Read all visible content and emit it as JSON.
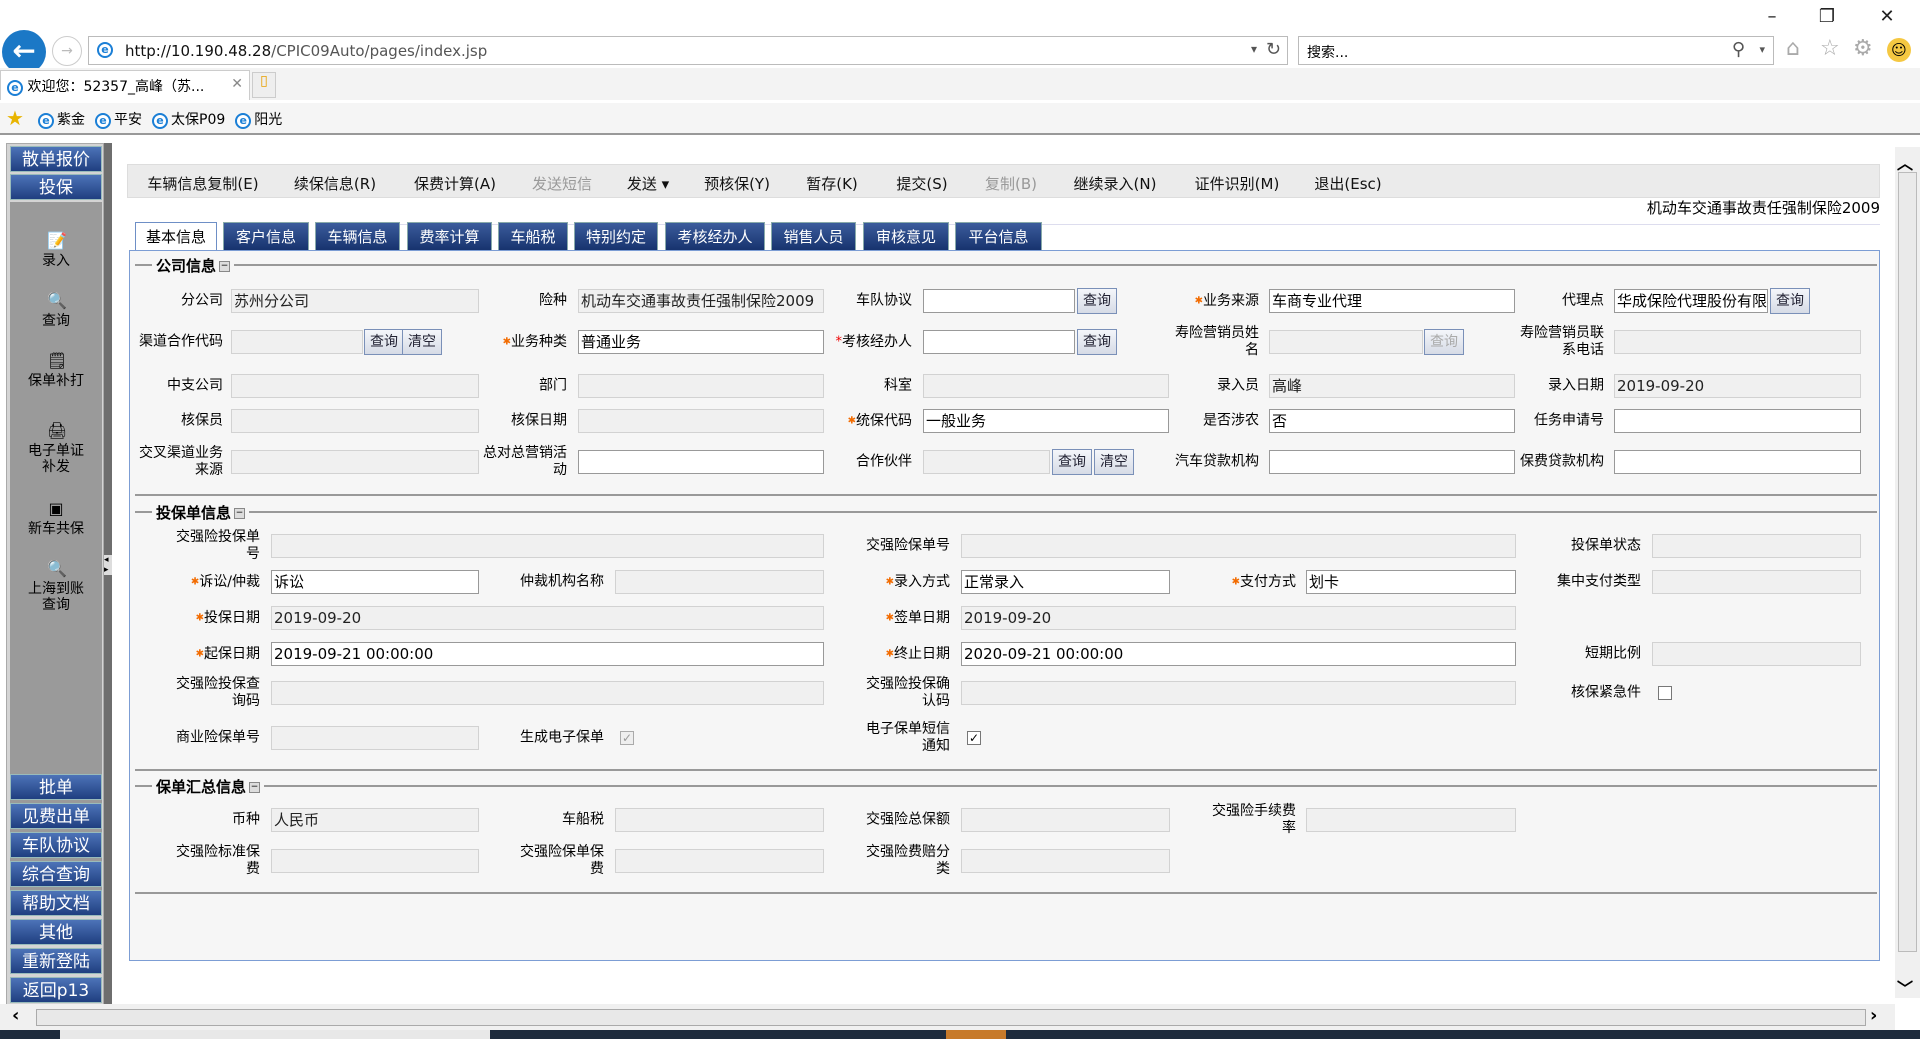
{
  "browser": {
    "url_host": "http://10.190.48.28",
    "url_path": "/CPIC09Auto/pages/index.jsp",
    "search_placeholder": "搜索...",
    "tab_title": "欢迎您：52357_高峰（苏...",
    "favorites": [
      "紫金",
      "平安",
      "太保P09",
      "阳光"
    ],
    "icons": [
      "back-icon",
      "forward-icon",
      "refresh-icon",
      "search-icon",
      "home-icon",
      "star-icon",
      "gear-icon",
      "smiley-icon"
    ]
  },
  "sidebar": {
    "top_buttons": [
      "散单报价",
      "投保"
    ],
    "items": [
      {
        "label": "录入",
        "icon": "edit-doc-icon"
      },
      {
        "label": "查询",
        "icon": "magnifier-icon"
      },
      {
        "label": "保单补打",
        "icon": "print-edit-icon"
      },
      {
        "label": "电子单证补发",
        "icon": "printer-icon"
      },
      {
        "label": "新车共保",
        "icon": "cube-icon"
      },
      {
        "label": "上海到账查询",
        "icon": "magnifier-icon"
      }
    ],
    "bottom_buttons": [
      "批单",
      "见费出单",
      "车队协议",
      "综合查询",
      "帮助文档",
      "其他",
      "重新登陆",
      "返回p13"
    ]
  },
  "toolbar": [
    {
      "label": "车辆信息复制(E)",
      "enabled": true
    },
    {
      "label": "续保信息(R)",
      "enabled": true
    },
    {
      "label": "保费计算(A)",
      "enabled": true
    },
    {
      "label": "发送短信",
      "enabled": false
    },
    {
      "label": "发送 ▾",
      "enabled": true
    },
    {
      "label": "预核保(Y)",
      "enabled": true
    },
    {
      "label": "暂存(K)",
      "enabled": true
    },
    {
      "label": "提交(S)",
      "enabled": true
    },
    {
      "label": "复制(B)",
      "enabled": false
    },
    {
      "label": "继续录入(N)",
      "enabled": true
    },
    {
      "label": "证件识别(M)",
      "enabled": true
    },
    {
      "label": "退出(Esc)",
      "enabled": true
    }
  ],
  "product_name": "机动车交通事故责任强制保险2009",
  "tabs": [
    "基本信息",
    "客户信息",
    "车辆信息",
    "费率计算",
    "车船税",
    "特别约定",
    "考核经办人",
    "销售人员",
    "审核意见",
    "平台信息"
  ],
  "active_tab": 0,
  "sections": [
    {
      "title": "公司信息",
      "fields": [
        {
          "label": "分公司",
          "value": "苏州分公司",
          "editable": false
        },
        {
          "label": "险种",
          "value": "机动车交通事故责任强制保险2009",
          "editable": false
        },
        {
          "label": "车队协议",
          "value": "",
          "editable": true,
          "buttons": [
            "查询"
          ]
        },
        {
          "label": "业务来源",
          "value": "车商专业代理",
          "editable": true,
          "required": "orange"
        },
        {
          "label": "代理点",
          "value": "华成保险代理股份有限",
          "editable": true,
          "buttons": [
            "查询"
          ]
        },
        {
          "label": "渠道合作代码",
          "value": "",
          "editable": false,
          "buttons": [
            "查询",
            "清空"
          ]
        },
        {
          "label": "业务种类",
          "value": "普通业务",
          "editable": true,
          "required": "orange"
        },
        {
          "label": "考核经办人",
          "value": "",
          "editable": true,
          "required": "red",
          "buttons": [
            "查询"
          ]
        },
        {
          "label": "寿险营销员姓名",
          "value": "",
          "editable": false,
          "buttons": [
            "查询"
          ],
          "buttons_disabled": true
        },
        {
          "label": "寿险营销员联系电话",
          "value": "",
          "editable": false
        },
        {
          "label": "中支公司",
          "value": "",
          "editable": false
        },
        {
          "label": "部门",
          "value": "",
          "editable": false
        },
        {
          "label": "科室",
          "value": "",
          "editable": false
        },
        {
          "label": "录入员",
          "value": "高峰",
          "editable": false
        },
        {
          "label": "录入日期",
          "value": "2019-09-20",
          "editable": false
        },
        {
          "label": "核保员",
          "value": "",
          "editable": false
        },
        {
          "label": "核保日期",
          "value": "",
          "editable": false
        },
        {
          "label": "统保代码",
          "value": "一般业务",
          "editable": true,
          "required": "orange"
        },
        {
          "label": "是否涉农",
          "value": "否",
          "editable": true
        },
        {
          "label": "任务申请号",
          "value": "",
          "editable": true
        },
        {
          "label": "交叉渠道业务来源",
          "value": "",
          "editable": false
        },
        {
          "label": "总对总营销活动",
          "value": "",
          "editable": true
        },
        {
          "label": "合作伙伴",
          "value": "",
          "editable": false,
          "buttons": [
            "查询",
            "清空"
          ]
        },
        {
          "label": "汽车贷款机构",
          "value": "",
          "editable": true
        },
        {
          "label": "保费贷款机构",
          "value": "",
          "editable": true
        }
      ]
    },
    {
      "title": "投保单信息",
      "fields": [
        {
          "label": "交强险投保单号",
          "value": "",
          "editable": false
        },
        {
          "label": "交强险保单号",
          "value": "",
          "editable": false
        },
        {
          "label": "投保单状态",
          "value": "",
          "editable": false
        },
        {
          "label": "诉讼/仲裁",
          "value": "诉讼",
          "editable": true,
          "required": "orange"
        },
        {
          "label": "仲裁机构名称",
          "value": "",
          "editable": false
        },
        {
          "label": "录入方式",
          "value": "正常录入",
          "editable": true,
          "required": "orange"
        },
        {
          "label": "支付方式",
          "value": "划卡",
          "editable": true,
          "required": "orange"
        },
        {
          "label": "集中支付类型",
          "value": "",
          "editable": false
        },
        {
          "label": "投保日期",
          "value": "2019-09-20",
          "editable": false,
          "required": "orange"
        },
        {
          "label": "签单日期",
          "value": "2019-09-20",
          "editable": false,
          "required": "orange"
        },
        {
          "label": "起保日期",
          "value": "2019-09-21 00:00:00",
          "editable": true,
          "required": "orange"
        },
        {
          "label": "终止日期",
          "value": "2020-09-21 00:00:00",
          "editable": true,
          "required": "orange"
        },
        {
          "label": "短期比例",
          "value": "",
          "editable": false
        },
        {
          "label": "交强险投保查询码",
          "value": "",
          "editable": false
        },
        {
          "label": "交强险投保确认码",
          "value": "",
          "editable": false
        },
        {
          "label": "核保紧急件",
          "type": "checkbox",
          "checked": false,
          "editable": true
        },
        {
          "label": "商业险保单号",
          "value": "",
          "editable": false
        },
        {
          "label": "生成电子保单",
          "type": "checkbox",
          "checked": true,
          "editable": false
        },
        {
          "label": "电子保单短信通知",
          "type": "checkbox",
          "checked": true,
          "editable": true
        }
      ]
    },
    {
      "title": "保单汇总信息",
      "fields": [
        {
          "label": "币种",
          "value": "人民币",
          "editable": false
        },
        {
          "label": "车船税",
          "value": "",
          "editable": false
        },
        {
          "label": "交强险总保额",
          "value": "",
          "editable": false
        },
        {
          "label": "交强险手续费率",
          "value": "",
          "editable": false
        },
        {
          "label": "交强险标准保费",
          "value": "",
          "editable": false
        },
        {
          "label": "交强险保单保费",
          "value": "",
          "editable": false
        },
        {
          "label": "交强险费赔分类",
          "value": "",
          "editable": false
        }
      ]
    }
  ]
}
